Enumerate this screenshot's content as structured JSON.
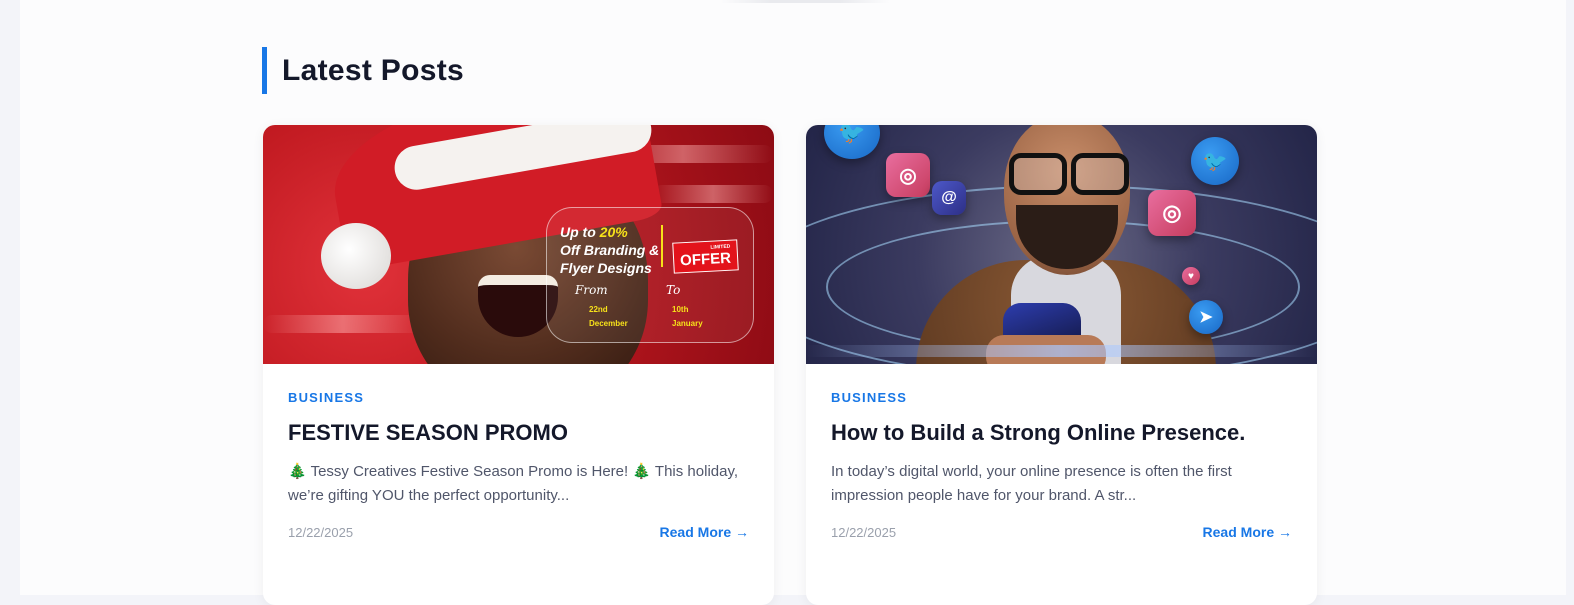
{
  "section": {
    "title": "Latest Posts"
  },
  "posts": [
    {
      "category": "BUSINESS",
      "title": "FESTIVE SEASON PROMO",
      "excerpt": "🎄 Tessy Creatives Festive Season Promo is Here! 🎄 This holiday, we’re gifting YOU the perfect opportunity...",
      "date": "12/22/2025",
      "read_more": "Read More →",
      "image": {
        "offer_line1_prefix": "Up to ",
        "offer_line1_highlight": "20%",
        "offer_line2": "Off Branding &",
        "offer_line3": "Flyer Designs",
        "badge_small": "LIMITED",
        "badge": "OFFER",
        "from_script": "From",
        "to_script": "To",
        "from_day": "22nd",
        "from_month": "December",
        "to_day": "10th",
        "to_month": "January"
      }
    },
    {
      "category": "BUSINESS",
      "title": "How to Build a Strong Online Presence.",
      "excerpt": "In today’s digital world, your online presence is often the first impression people have for your brand. A str...",
      "date": "12/22/2025",
      "read_more": "Read More →"
    }
  ],
  "colors": {
    "accent": "#1877e6",
    "heading": "#14182a",
    "body_text": "#50566a",
    "muted": "#9aa0ac",
    "page_bg": "#fcfcfd",
    "outer_bg": "#f3f4f9"
  },
  "icons": {
    "post_1_image": "santa-promo-image",
    "post_2_image": "social-media-image"
  }
}
